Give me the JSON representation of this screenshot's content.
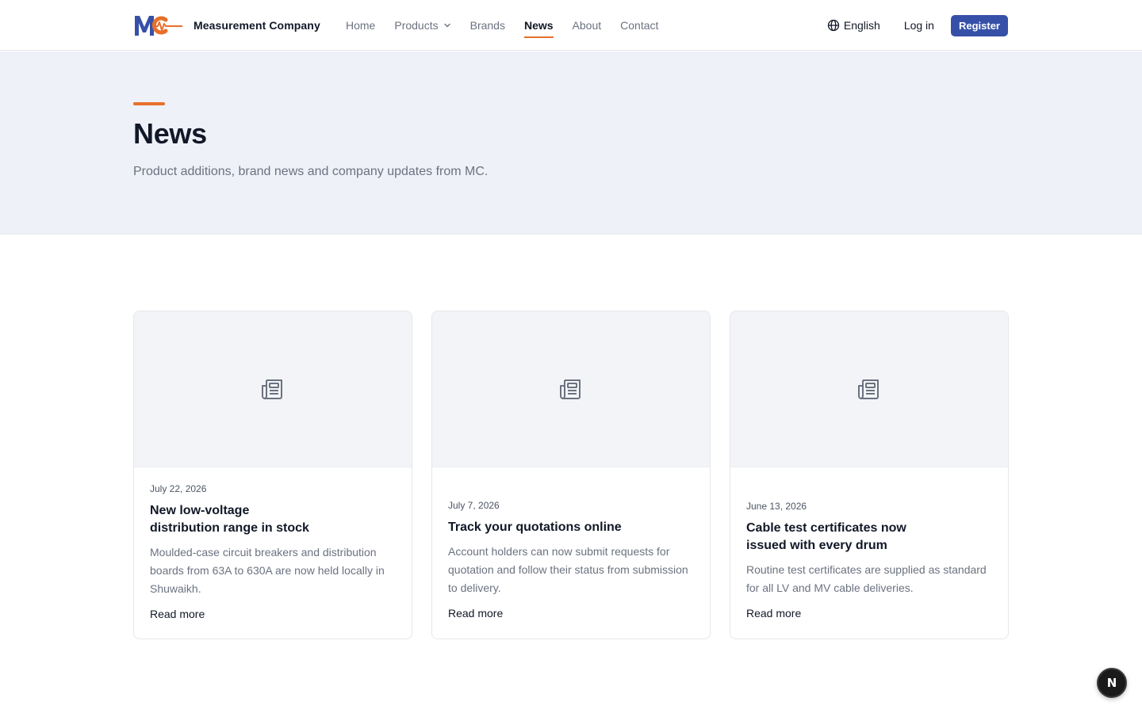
{
  "header": {
    "logo_icon": "mc-logo-icon",
    "brand_name": "Measurement Company",
    "nav": [
      {
        "label": "Home",
        "active": false
      },
      {
        "label": "Products",
        "active": false,
        "has_dropdown": true
      },
      {
        "label": "Brands",
        "active": false
      },
      {
        "label": "News",
        "active": true
      },
      {
        "label": "About",
        "active": false
      },
      {
        "label": "Contact",
        "active": false
      }
    ],
    "language": "English",
    "language_icon": "globe-icon",
    "login_label": "Log in",
    "register_label": "Register"
  },
  "hero": {
    "title": "News",
    "subtitle": "Product additions, brand news and company updates from MC."
  },
  "cards": [
    {
      "image_icon": "newspaper-icon",
      "date": "July 22, 2026",
      "title_line1": "New low-voltage",
      "title_line2": "distribution range in stock",
      "text": "Moulded-case circuit breakers and distribution boards from 63A to 630A are now held locally in Shuwaikh.",
      "link": "Read more"
    },
    {
      "image_icon": "newspaper-icon",
      "date": "July 7, 2026",
      "title_line1": "Track your quotations online",
      "title_line2": "",
      "text": "Account holders can now submit requests for quotation and follow their status from submission to delivery.",
      "link": "Read more"
    },
    {
      "image_icon": "newspaper-icon",
      "date": "June 13, 2026",
      "title_line1": "Cable test certificates now",
      "title_line2": "issued with every drum",
      "text": "Routine test certificates are supplied as standard for all LV and MV cable deliveries.",
      "link": "Read more"
    }
  ],
  "fab": {
    "label": "N"
  },
  "colors": {
    "accent": "#e76f2a",
    "brand_blue": "#3650a8",
    "hero_bg": "#eef1f8"
  }
}
